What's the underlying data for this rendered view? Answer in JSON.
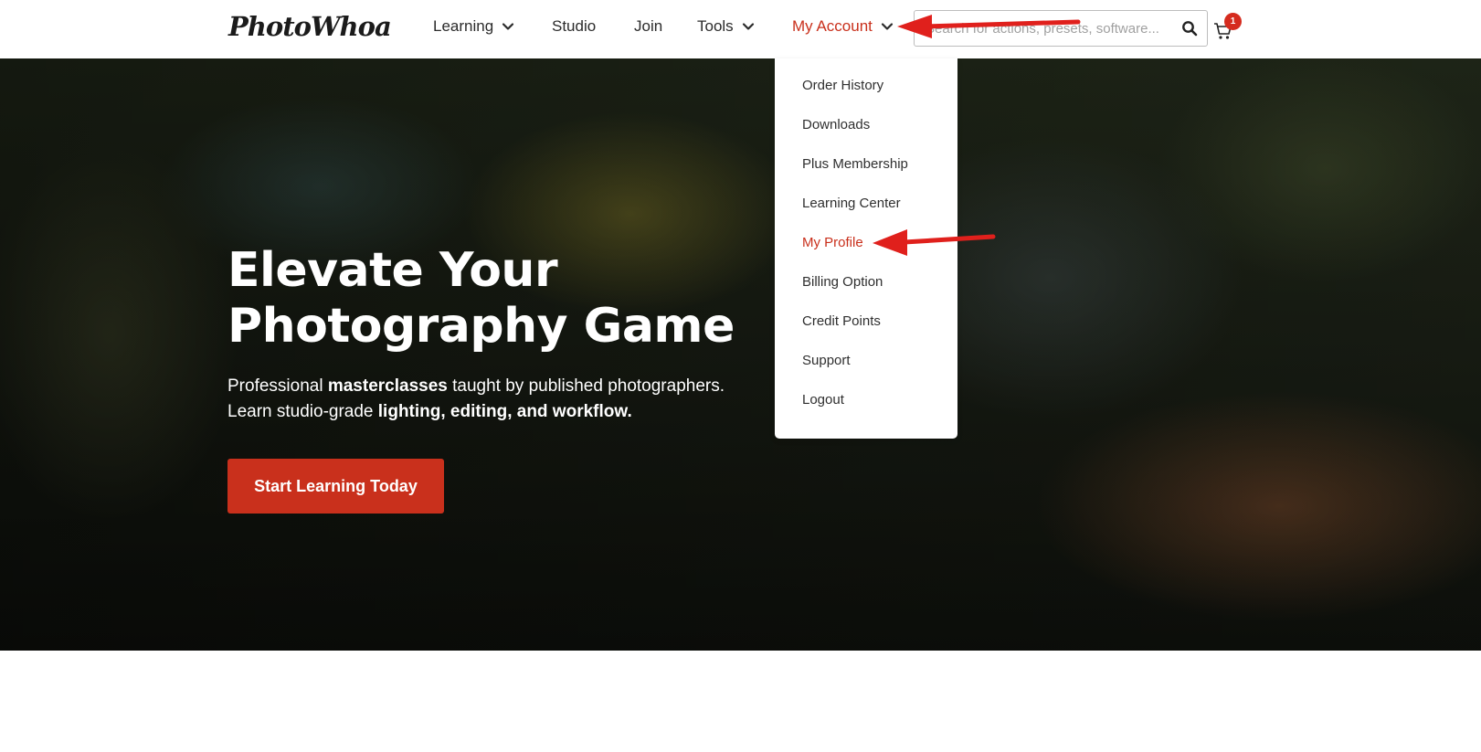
{
  "header": {
    "logo": "PhotoWhoa",
    "nav": [
      {
        "label": "Learning"
      },
      {
        "label": "Studio"
      },
      {
        "label": "Join"
      },
      {
        "label": "Tools"
      },
      {
        "label": "My Account"
      }
    ],
    "search": {
      "placeholder": "Search for actions, presets, software...",
      "value": ""
    },
    "cart": {
      "count": "1"
    }
  },
  "account_menu": {
    "items": [
      {
        "label": "Order History"
      },
      {
        "label": "Downloads"
      },
      {
        "label": "Plus Membership"
      },
      {
        "label": "Learning Center"
      },
      {
        "label": "My Profile"
      },
      {
        "label": "Billing Option"
      },
      {
        "label": "Credit Points"
      },
      {
        "label": "Support"
      },
      {
        "label": "Logout"
      }
    ]
  },
  "hero": {
    "title_line1": "Elevate Your",
    "title_line2": "Photography Game",
    "sub1_a": "Professional ",
    "sub1_b": "masterclasses",
    "sub1_c": " taught by published photographers.",
    "sub2_a": "Learn studio-grade ",
    "sub2_b": "lighting, editing, and workflow.",
    "cta_label": "Start Learning Today"
  },
  "colors": {
    "accent": "#c9301c",
    "badge": "#d52b1e",
    "annotation_arrow": "#e0201c"
  }
}
